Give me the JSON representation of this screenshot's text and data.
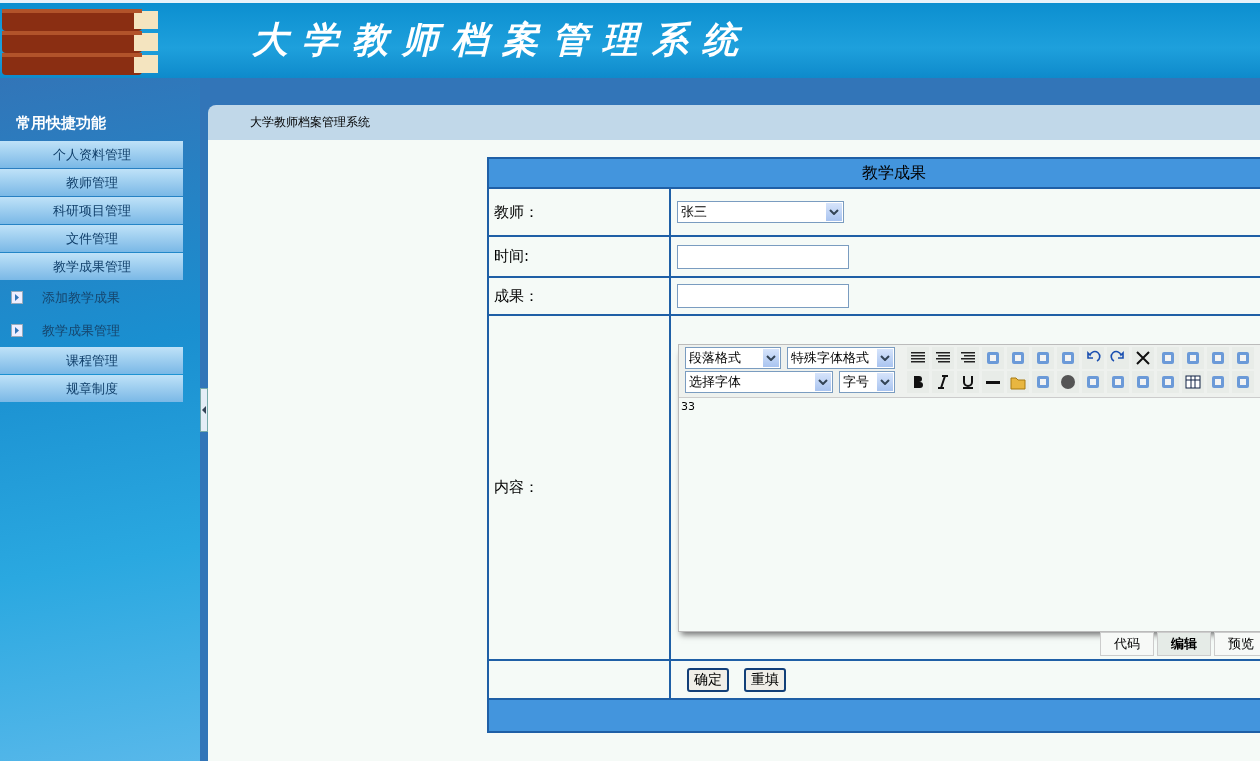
{
  "header": {
    "title": "大学教师档案管理系统"
  },
  "sidebar": {
    "title": "常用快捷功能",
    "items": [
      {
        "kind": "group",
        "label": "个人资料管理"
      },
      {
        "kind": "group",
        "label": "教师管理"
      },
      {
        "kind": "group",
        "label": "科研项目管理"
      },
      {
        "kind": "group",
        "label": "文件管理"
      },
      {
        "kind": "group",
        "label": "教学成果管理"
      },
      {
        "kind": "link",
        "label": "添加教学成果"
      },
      {
        "kind": "link",
        "label": "教学成果管理"
      },
      {
        "kind": "group",
        "label": "课程管理"
      },
      {
        "kind": "group",
        "label": "规章制度"
      }
    ]
  },
  "breadcrumb": "大学教师档案管理系统",
  "form": {
    "title": "教学成果",
    "teacher": {
      "label": "教师：",
      "value": "张三"
    },
    "time": {
      "label": "时间:"
    },
    "result": {
      "label": "成果："
    },
    "content": {
      "label": "内容：",
      "selects": [
        {
          "value": "段落格式"
        },
        {
          "value": "特殊字体格式"
        },
        {
          "value": "选择字体"
        },
        {
          "value": "字号"
        }
      ],
      "text": "33",
      "tabs": [
        {
          "label": "代码",
          "selected": false
        },
        {
          "label": "编辑",
          "selected": true
        },
        {
          "label": "预览",
          "selected": false
        }
      ]
    },
    "buttons": [
      "确定",
      "重填"
    ]
  }
}
